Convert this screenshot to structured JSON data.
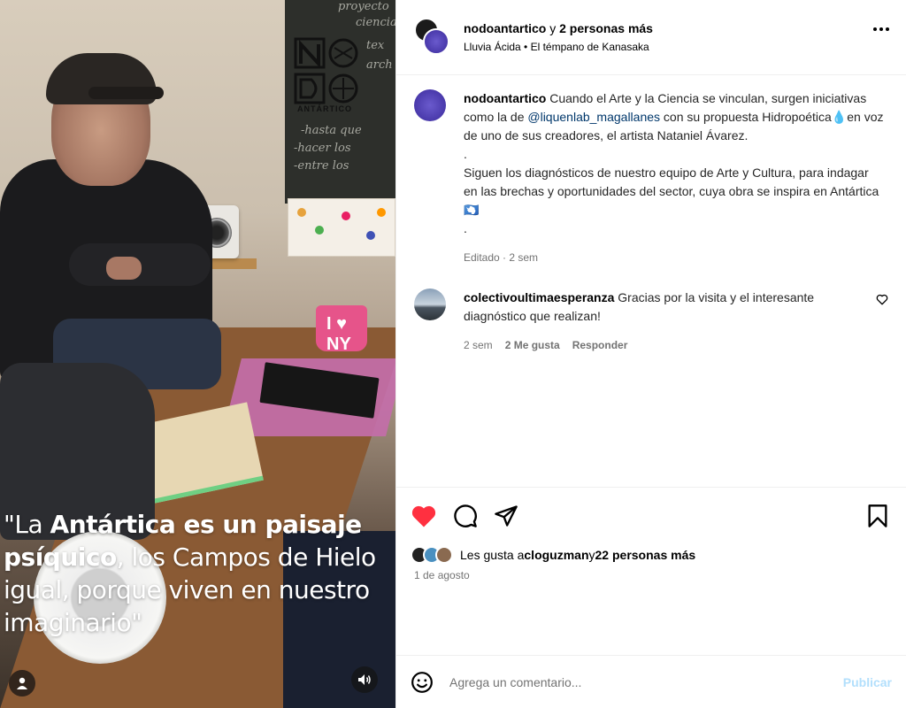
{
  "media": {
    "logo_text": "ANTÁRTICO",
    "chalk": [
      "proyecto",
      "ciencia",
      "tex",
      "arch",
      "-hasta que",
      "-hacer los",
      "-entre los"
    ],
    "mug_text": "I ♥ NY",
    "caption_parts": [
      "\"La ",
      "Antártica es un paisaje psíquico",
      ", los Campos de Hielo igual, porque viven en nuestro imaginario\""
    ],
    "user_icon": "user-icon",
    "sound_icon": "speaker-icon"
  },
  "header": {
    "username": "nodoantartico",
    "connector": " y ",
    "others": "2 personas más",
    "audio": "Lluvia Ácida",
    "separator": " • ",
    "location": "El témpano de Kanasaka",
    "more_icon": "more-options-icon"
  },
  "post": {
    "username": "nodoantartico",
    "text_before": " Cuando el Arte y la Ciencia se vinculan, surgen iniciativas como la de ",
    "mention": "@liquenlab_magallanes",
    "text_after": " con su propuesta Hidropoética💧en voz de uno de sus creadores, el artista Nataniel Ávarez.",
    "dot1": ".",
    "paragraph2": "Siguen los diagnósticos de nuestro equipo de Arte y Cultura, para indagar en las brechas y oportunidades del sector, cuya obra se inspira en Antártica 🇦🇶",
    "dot2": ".",
    "meta": "Editado · 2 sem"
  },
  "comment": {
    "username": "colectivoultimaesperanza",
    "text": " Gracias por la visita y el interesante diagnóstico que realizan!",
    "time": "2 sem",
    "likes": "2 Me gusta",
    "reply": "Responder"
  },
  "actions": {
    "likes_prefix": "Les gusta a ",
    "likes_user": "cloguzman",
    "likes_connector": " y ",
    "likes_others": "22 personas más",
    "date": "1 de agosto"
  },
  "compose": {
    "placeholder": "Agrega un comentario...",
    "publish": "Publicar"
  },
  "colors": {
    "like_red": "#ff3040",
    "mention_blue": "#00376b",
    "publish_disabled": "#b2dffc"
  }
}
